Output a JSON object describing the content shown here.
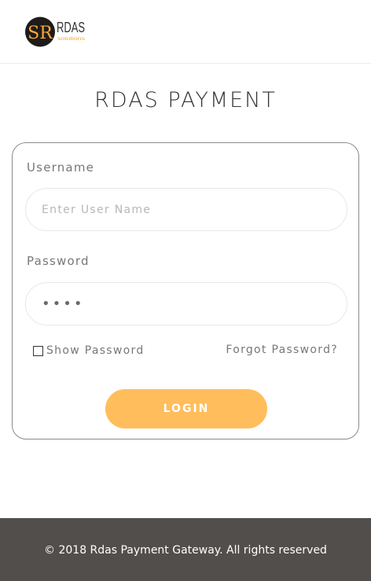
{
  "header": {
    "logo": {
      "monogram": "SR",
      "wordmark": "RDAS",
      "tagline": "solutions",
      "colors": {
        "circle": "#1e1b1a",
        "accent": "#f4a93a",
        "text": "#333333"
      }
    }
  },
  "main": {
    "title": "RDAS PAYMENT"
  },
  "login_form": {
    "username_label": "Username",
    "username_placeholder": "Enter User Name",
    "username_value": "",
    "password_label": "Password",
    "password_value": "••••",
    "show_password_label": "Show Password",
    "show_password_checked": false,
    "forgot_password_label": "Forgot Password?",
    "login_button_label": "LOGIN"
  },
  "footer": {
    "text": "© 2018 Rdas Payment Gateway. All rights reserved"
  },
  "colors": {
    "button": "#ffbd5c",
    "footer_bg": "#524e4c",
    "label_text": "#7a7676"
  }
}
